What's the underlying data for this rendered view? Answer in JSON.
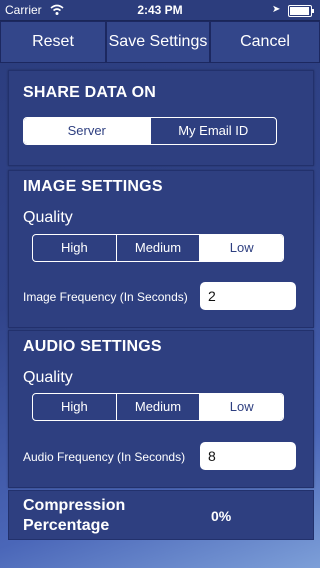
{
  "status_bar": {
    "carrier": "Carrier",
    "time": "2:43 PM"
  },
  "toolbar": {
    "reset_label": "Reset",
    "save_label": "Save Settings",
    "cancel_label": "Cancel"
  },
  "share_data": {
    "title": "SHARE DATA ON",
    "options": [
      "Server",
      "My Email ID"
    ],
    "selected": "Server"
  },
  "image_settings": {
    "title": "IMAGE SETTINGS",
    "quality_label": "Quality",
    "quality_options": [
      "High",
      "Medium",
      "Low"
    ],
    "quality_selected": "Low",
    "frequency_label": "Image Frequency (In Seconds)",
    "frequency_value": "2"
  },
  "audio_settings": {
    "title": "AUDIO SETTINGS",
    "quality_label": "Quality",
    "quality_options": [
      "High",
      "Medium",
      "Low"
    ],
    "quality_selected": "Low",
    "frequency_label": "Audio Frequency (In Seconds)",
    "frequency_value": "8"
  },
  "compression": {
    "label_line1": "Compression",
    "label_line2": "Percentage",
    "value": "0%"
  }
}
